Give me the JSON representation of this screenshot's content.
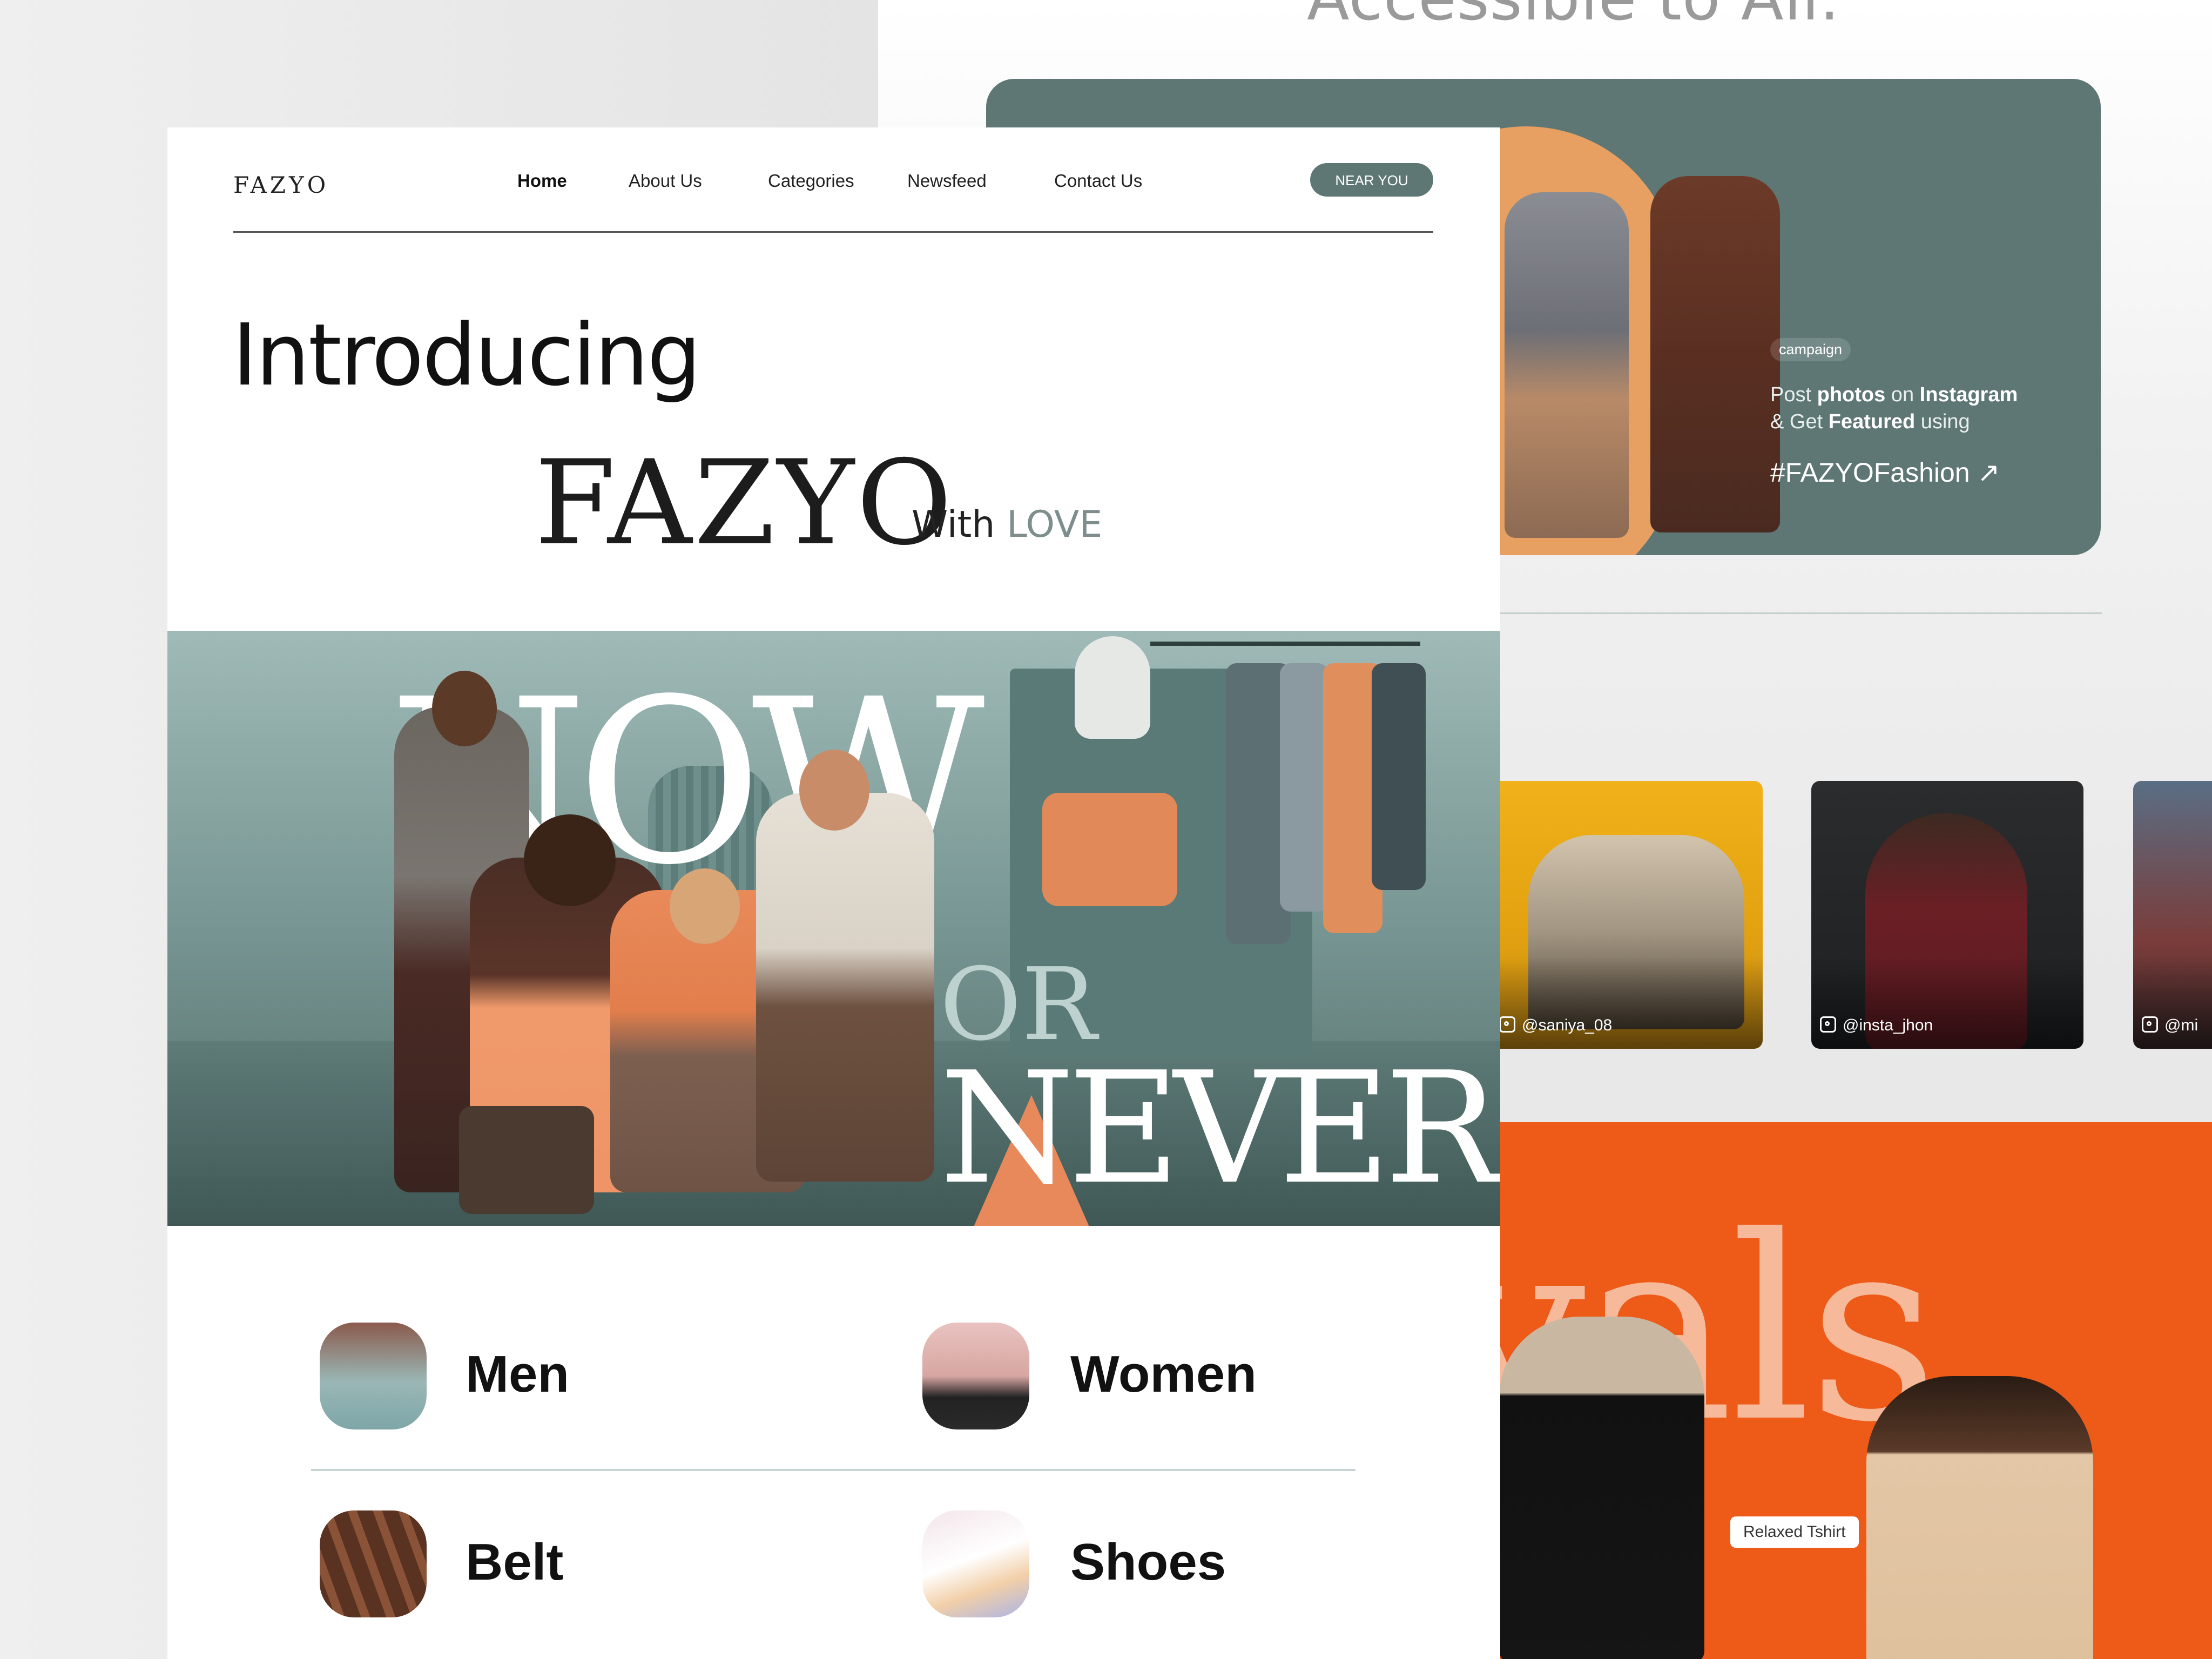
{
  "background_page": {
    "headline": "Accessible to All.",
    "campaign": {
      "tag": "campaign",
      "line1_pre": "Post ",
      "line1_bold1": "photos",
      "line1_mid": " on ",
      "line1_bold2": "Instagram",
      "line2_pre": "&  Get ",
      "line2_bold": "Featured",
      "line2_post": " using",
      "hashtag": "#FAZYOFashion ↗"
    },
    "instagram_posts": [
      {
        "handle": "@saniya_08"
      },
      {
        "handle": "@insta_jhon"
      },
      {
        "handle": "@mi"
      }
    ],
    "arrivals_word": "ivals",
    "product_label": "Relaxed Tshirt"
  },
  "header": {
    "logo": "FAZYO",
    "nav": [
      "Home",
      "About Us",
      "Categories",
      "Newsfeed",
      "Contact Us"
    ],
    "cta": "NEAR YOU"
  },
  "intro": {
    "title": "Introducing",
    "brand": "FAZYO",
    "tagline_with": "With ",
    "tagline_love": "LOVE"
  },
  "hero": {
    "word1": "NOW",
    "word2": "OR",
    "word3": "NEVER"
  },
  "categories": [
    {
      "label": "Men"
    },
    {
      "label": "Women"
    },
    {
      "label": "Belt"
    },
    {
      "label": "Shoes"
    }
  ],
  "colors": {
    "accent_teal": "#5e7775",
    "accent_orange": "#ee5a17",
    "hero_bg": "#7b9996"
  }
}
